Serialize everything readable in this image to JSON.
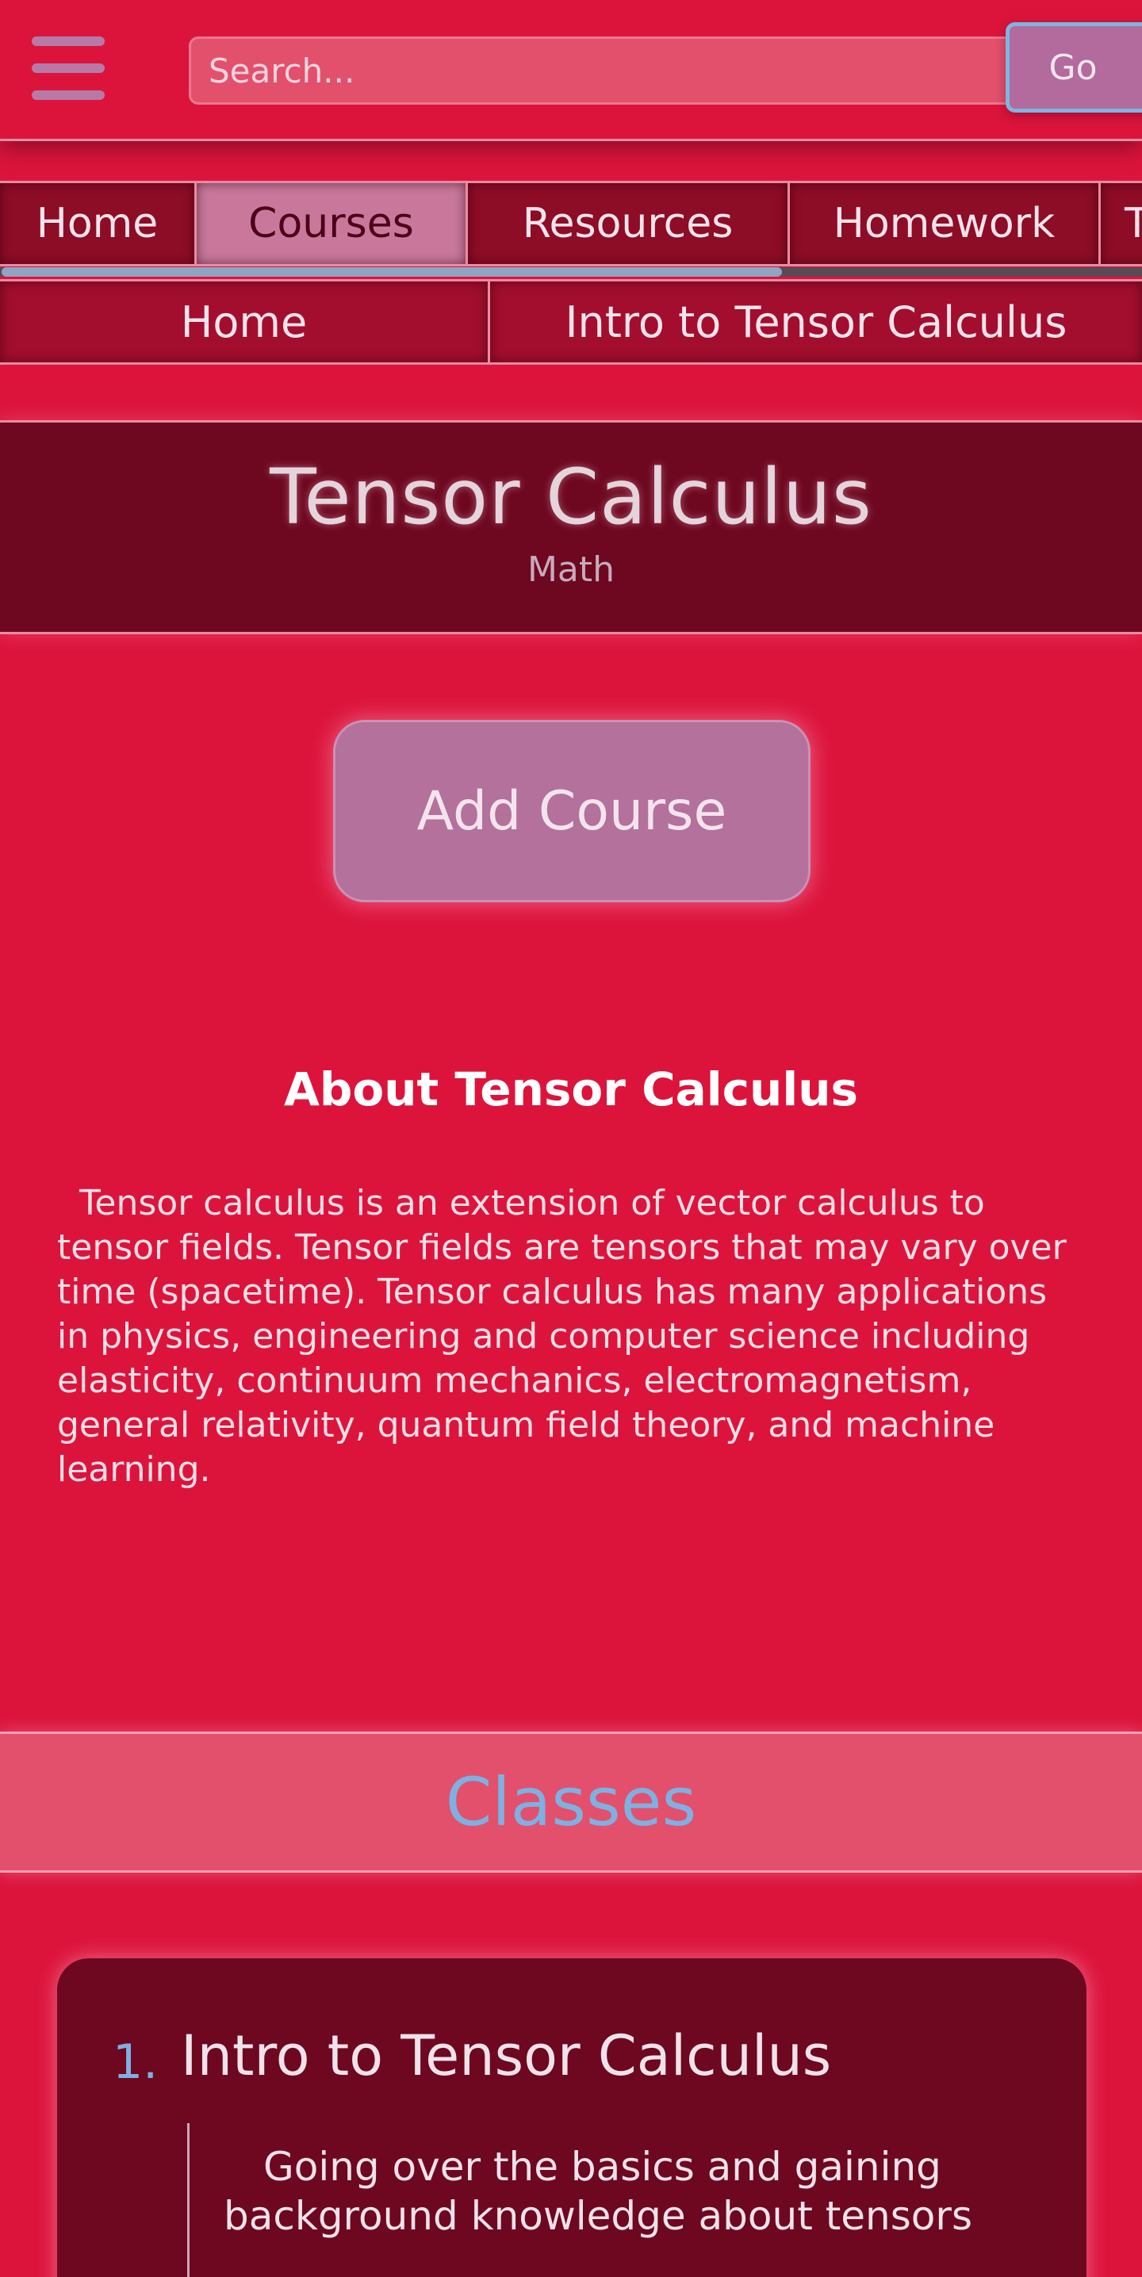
{
  "header": {
    "menu_icon": "hamburger-menu-icon",
    "search_placeholder": "Search...",
    "search_button": "Go"
  },
  "nav": {
    "tabs": [
      {
        "label": "Home",
        "active": false
      },
      {
        "label": "Courses",
        "active": true
      },
      {
        "label": "Resources",
        "active": false
      },
      {
        "label": "Homework",
        "active": false
      },
      {
        "label": "T",
        "active": false
      }
    ]
  },
  "breadcrumb": {
    "items": [
      "Home",
      "Intro to Tensor Calculus"
    ]
  },
  "course": {
    "title": "Tensor Calculus",
    "subject": "Math",
    "add_button": "Add Course"
  },
  "about": {
    "heading": "About Tensor Calculus",
    "text": "Tensor calculus is an extension of vector calculus to tensor fields. Tensor fields are tensors that may vary over time (spacetime). Tensor calculus has many applications in physics, engineering and computer science including elasticity, continuum mechanics, electromagnetism, general relativity, quantum field theory, and machine learning."
  },
  "classes": {
    "heading": "Classes",
    "items": [
      {
        "number": "1.",
        "title": "Intro to Tensor Calculus",
        "description": "Going over the basics and gaining background knowledge about tensors"
      }
    ]
  },
  "colors": {
    "background": "#dc143c",
    "header_panel": "#6d0820",
    "accent_blue": "#7fb0e2",
    "button_mauve": "#b3719c"
  }
}
